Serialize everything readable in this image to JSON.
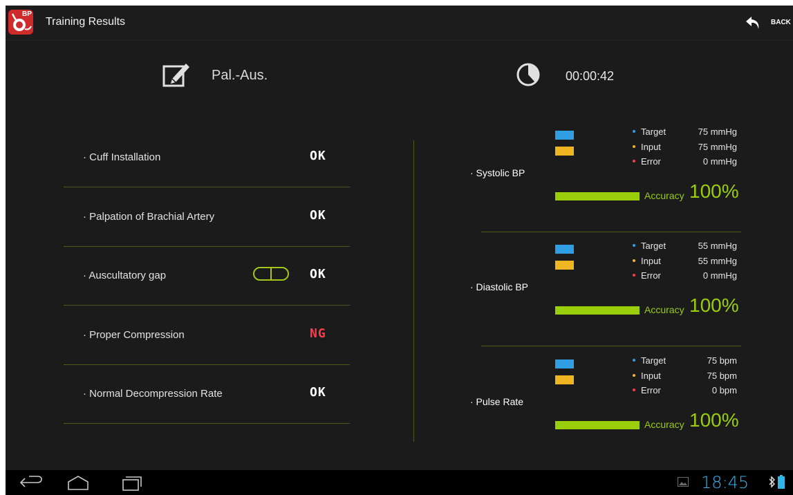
{
  "actionbar": {
    "app_icon_text": "BP",
    "title": "Training Results",
    "back_label": "BACK"
  },
  "header": {
    "mode_label": "Pal.-Aus.",
    "elapsed_time": "00:00:42"
  },
  "checklist": [
    {
      "label": "· Cuff Installation",
      "result": "OK",
      "result_color": "#ffffff"
    },
    {
      "label": "· Palpation of Brachial Artery",
      "result": "OK",
      "result_color": "#ffffff"
    },
    {
      "label": "· Auscultatory gap",
      "result": "OK",
      "result_color": "#ffffff",
      "toggle": true
    },
    {
      "label": "· Proper Compression",
      "result": "NG",
      "result_color": "#ff3b4e"
    },
    {
      "label": "· Normal Decompression Rate",
      "result": "OK",
      "result_color": "#ffffff"
    }
  ],
  "measurements": [
    {
      "label": "· Systolic BP",
      "target_label": "Target",
      "target_value": "75 mmHg",
      "input_label": "Input",
      "input_value": "75 mmHg",
      "error_label": "Error",
      "error_value": "0 mmHg",
      "accuracy_label": "Accuracy",
      "accuracy_value": "100%"
    },
    {
      "label": "· Diastolic BP",
      "target_label": "Target",
      "target_value": "55 mmHg",
      "input_label": "Input",
      "input_value": "55 mmHg",
      "error_label": "Error",
      "error_value": "0 mmHg",
      "accuracy_label": "Accuracy",
      "accuracy_value": "100%"
    },
    {
      "label": "· Pulse Rate",
      "target_label": "Target",
      "target_value": "75 bpm",
      "input_label": "Input",
      "input_value": "75 bpm",
      "error_label": "Error",
      "error_value": "0 bpm",
      "accuracy_label": "Accuracy",
      "accuracy_value": "100%"
    }
  ],
  "colors": {
    "accent_green": "#9acd0a",
    "target_blue": "#2f9ee2",
    "input_orange": "#f0b523",
    "error_red": "#ff3b4e",
    "ng_red": "#ff3b4e"
  },
  "sysbar": {
    "time": "18:45"
  }
}
